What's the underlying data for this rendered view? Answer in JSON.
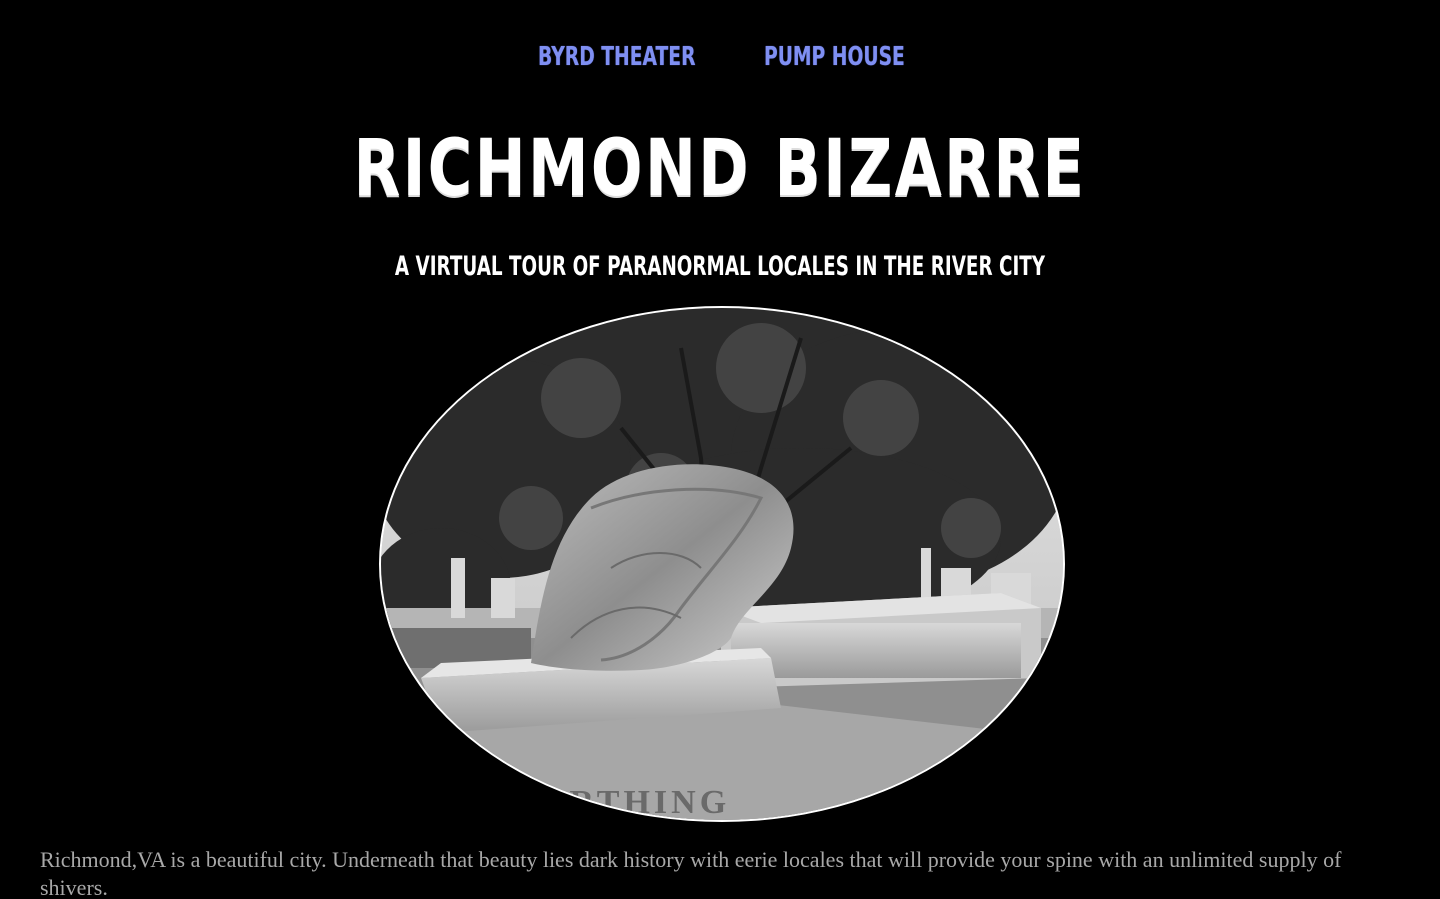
{
  "nav": {
    "links": [
      {
        "label": "BYRD THEATER"
      },
      {
        "label": "PUMP HOUSE"
      }
    ]
  },
  "header": {
    "title": "RICHMOND BIZARRE",
    "subtitle": "A VIRTUAL TOUR OF PARANORMAL LOCALES IN THE RIVER CITY"
  },
  "hero": {
    "image_name": "weeping-statue-photo",
    "engraving": "WORTHING"
  },
  "intro": {
    "text": "Richmond,VA is a beautiful city. Underneath that beauty lies dark history with eerie locales that will provide your spine with an unlimited supply of shivers."
  },
  "colors": {
    "background": "#000000",
    "nav_link": "#7f8ff2",
    "heading": "#ffffff",
    "body_text": "#a8a8a8"
  }
}
